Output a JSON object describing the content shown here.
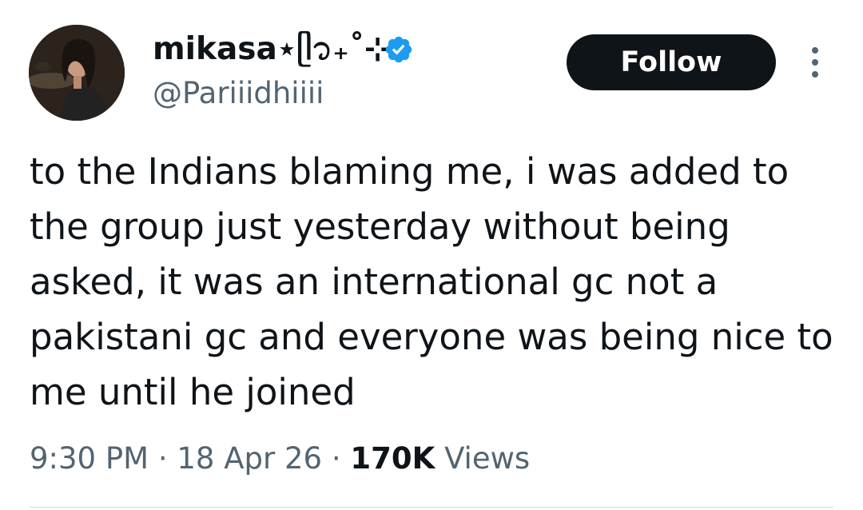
{
  "author": {
    "display_name": "mikasa⋆ᥫ᭡₊˚⊹",
    "handle": "@Pariiidhiiii",
    "avatar_icon": "profile-photo",
    "verified_icon": "verified-badge-icon",
    "verified_color": "#1d9bf0"
  },
  "follow_button": {
    "label": "Follow",
    "bg_color": "#0f1419",
    "text_color": "#ffffff"
  },
  "more_icon": "more-vertical-icon",
  "tweet": {
    "text": "to the Indians blaming me, i was added to the group just yesterday without being asked, it was an international gc not a pakistani gc and everyone was being nice to me until he joined"
  },
  "meta": {
    "time": "9:30 PM",
    "separator": "·",
    "date": "18 Apr 26",
    "views_count": "170K",
    "views_label": "Views"
  },
  "colors": {
    "primary_text": "#0f1419",
    "secondary_text": "#536471",
    "divider": "#cfd9de"
  }
}
